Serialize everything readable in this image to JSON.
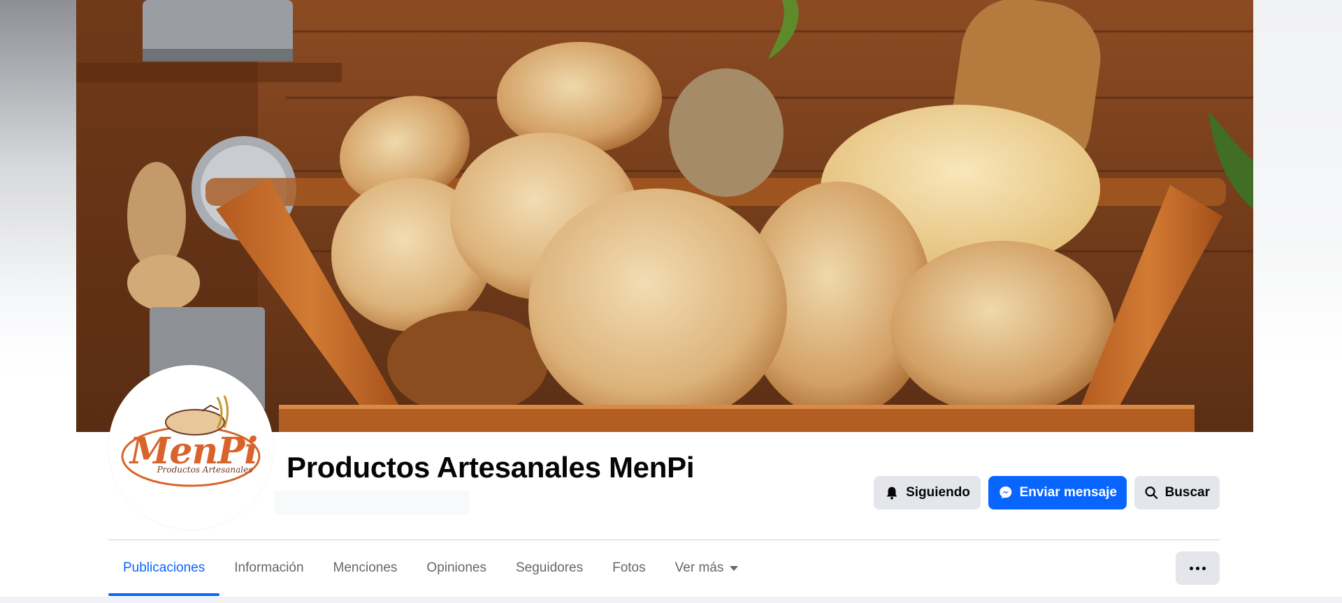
{
  "page": {
    "name": "Productos Artesanales MenPi",
    "logo_word": "MenPi",
    "logo_sub": "Productos Artesanales"
  },
  "actions": {
    "following_label": "Siguiendo",
    "message_label": "Enviar mensaje",
    "search_label": "Buscar"
  },
  "tabs": [
    {
      "label": "Publicaciones",
      "active": true
    },
    {
      "label": "Información"
    },
    {
      "label": "Menciones"
    },
    {
      "label": "Opiniones"
    },
    {
      "label": "Seguidores"
    },
    {
      "label": "Fotos"
    },
    {
      "label": "Ver más"
    }
  ],
  "icons": {
    "following": "bell-icon",
    "message": "messenger-icon",
    "search": "search-icon",
    "more": "more-options-icon",
    "ver_mas": "caret-down-icon"
  },
  "colors": {
    "accent": "#0866ff",
    "button_grey": "#e4e6eb",
    "logo_orange": "#d8632b"
  }
}
